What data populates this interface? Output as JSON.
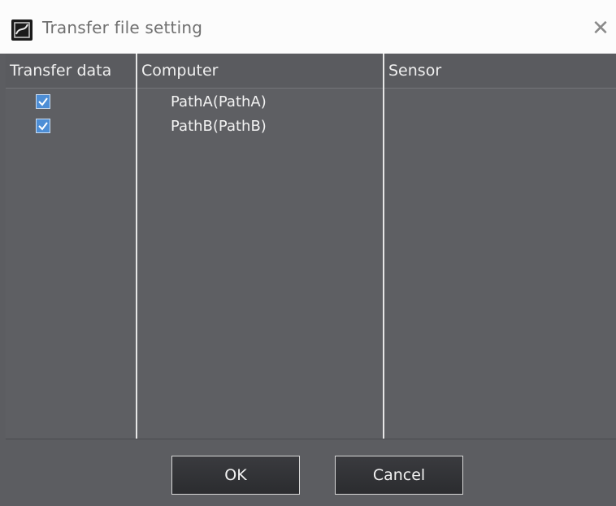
{
  "dialog": {
    "title": "Transfer file setting",
    "close_icon": "close-icon",
    "app_icon": "app-icon"
  },
  "table": {
    "columns": [
      "Transfer data",
      "Computer",
      "Sensor"
    ],
    "rows": [
      {
        "checked": true,
        "computer": "PathA(PathA)",
        "sensor": ""
      },
      {
        "checked": true,
        "computer": "PathB(PathB)",
        "sensor": ""
      }
    ]
  },
  "buttons": {
    "ok_label": "OK",
    "cancel_label": "Cancel"
  },
  "colors": {
    "panel": "#5c5d61",
    "checkbox": "#4d8ed6",
    "button": "#2b2c2f"
  }
}
